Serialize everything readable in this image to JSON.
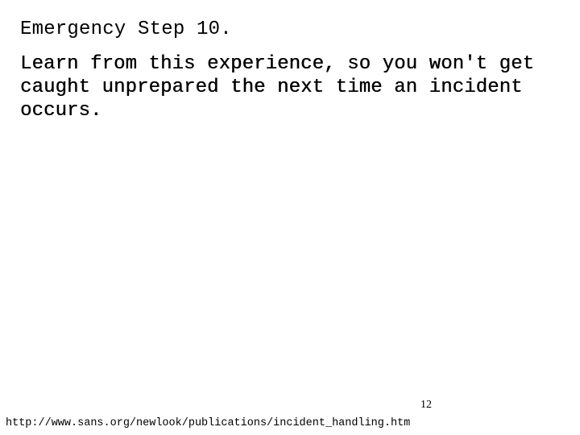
{
  "slide": {
    "title": "Emergency Step 10.",
    "body_lines": [
      "Learn from this experience, so you won't get",
      "caught unprepared the next time an incident",
      "occurs."
    ],
    "page_number": "12",
    "source_url": "http://www.sans.org/newlook/publications/incident_handling.htm"
  }
}
